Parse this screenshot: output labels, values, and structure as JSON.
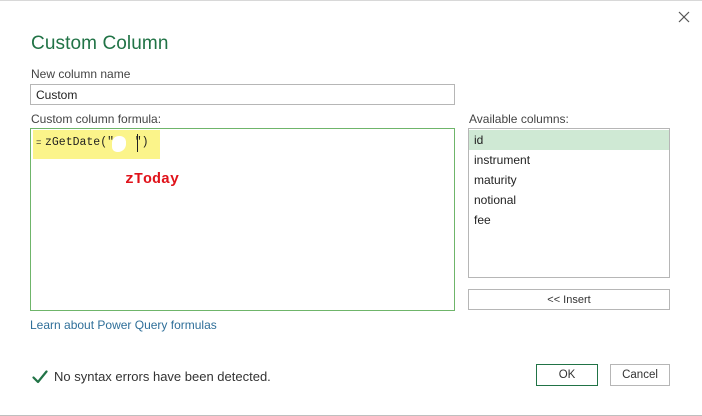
{
  "dialog": {
    "title": "Custom Column",
    "close_icon": "close-icon"
  },
  "new_column": {
    "label": "New column name",
    "value": "Custom"
  },
  "formula": {
    "label": "Custom column formula:",
    "equals_sign": "=",
    "text": "zGetDate(\"   \")",
    "annotation": "zToday",
    "highlight_color": "#fbf48a",
    "annotation_color": "#e0131b"
  },
  "available_columns": {
    "label": "Available columns:",
    "items": [
      "id",
      "instrument",
      "maturity",
      "notional",
      "fee"
    ],
    "selected": "id"
  },
  "insert_button": "<< Insert",
  "learn_link": "Learn about Power Query formulas",
  "status": {
    "icon": "checkmark-icon",
    "text": "No syntax errors have been detected."
  },
  "buttons": {
    "ok": "OK",
    "cancel": "Cancel"
  },
  "colors": {
    "accent": "#217346",
    "link": "#2f6f99",
    "selection": "#cfe9d4"
  }
}
